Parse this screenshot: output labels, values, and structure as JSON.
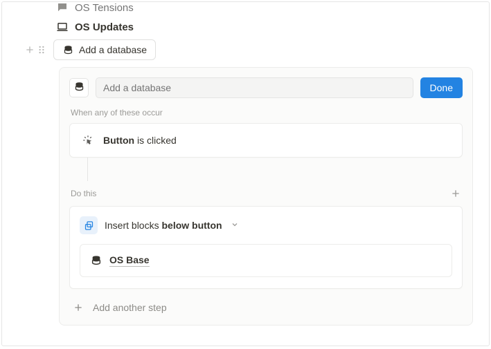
{
  "nav": {
    "items": [
      {
        "label": "OS Tensions"
      },
      {
        "label": "OS Updates"
      }
    ]
  },
  "block_button": {
    "label": "Add a database"
  },
  "automation": {
    "input_placeholder": "Add a database",
    "done_label": "Done",
    "trigger_section_label": "When any of these occur",
    "trigger": {
      "bold": "Button",
      "rest": " is clicked"
    },
    "action_section_label": "Do this",
    "action": {
      "prefix": "Insert blocks ",
      "bold": "below button"
    },
    "insert_target": "OS Base",
    "add_step_label": "Add another step"
  }
}
